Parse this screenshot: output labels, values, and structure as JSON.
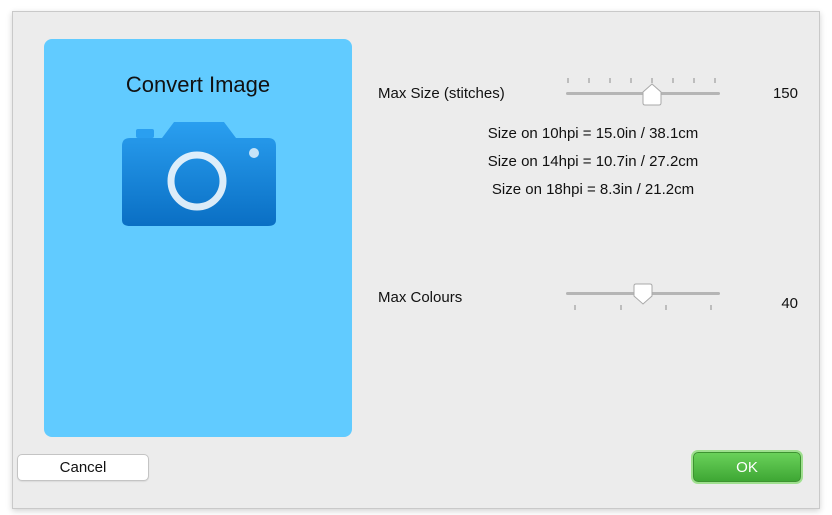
{
  "panel": {
    "title": "Convert Image"
  },
  "max_size": {
    "label": "Max Size (stitches)",
    "value": "150",
    "level": 0.65
  },
  "sizes": [
    "Size on 10hpi = 15.0in / 38.1cm",
    "Size on 14hpi = 10.7in / 27.2cm",
    "Size on 18hpi = 8.3in / 21.2cm"
  ],
  "max_colours": {
    "label": "Max Colours",
    "value": "40",
    "level": 0.5
  },
  "buttons": {
    "cancel": "Cancel",
    "ok": "OK"
  },
  "colors": {
    "panel": "#61cbff",
    "camera": "#1a8fe0",
    "ok": "#3ea734"
  },
  "icons": {
    "camera": "camera-icon"
  }
}
